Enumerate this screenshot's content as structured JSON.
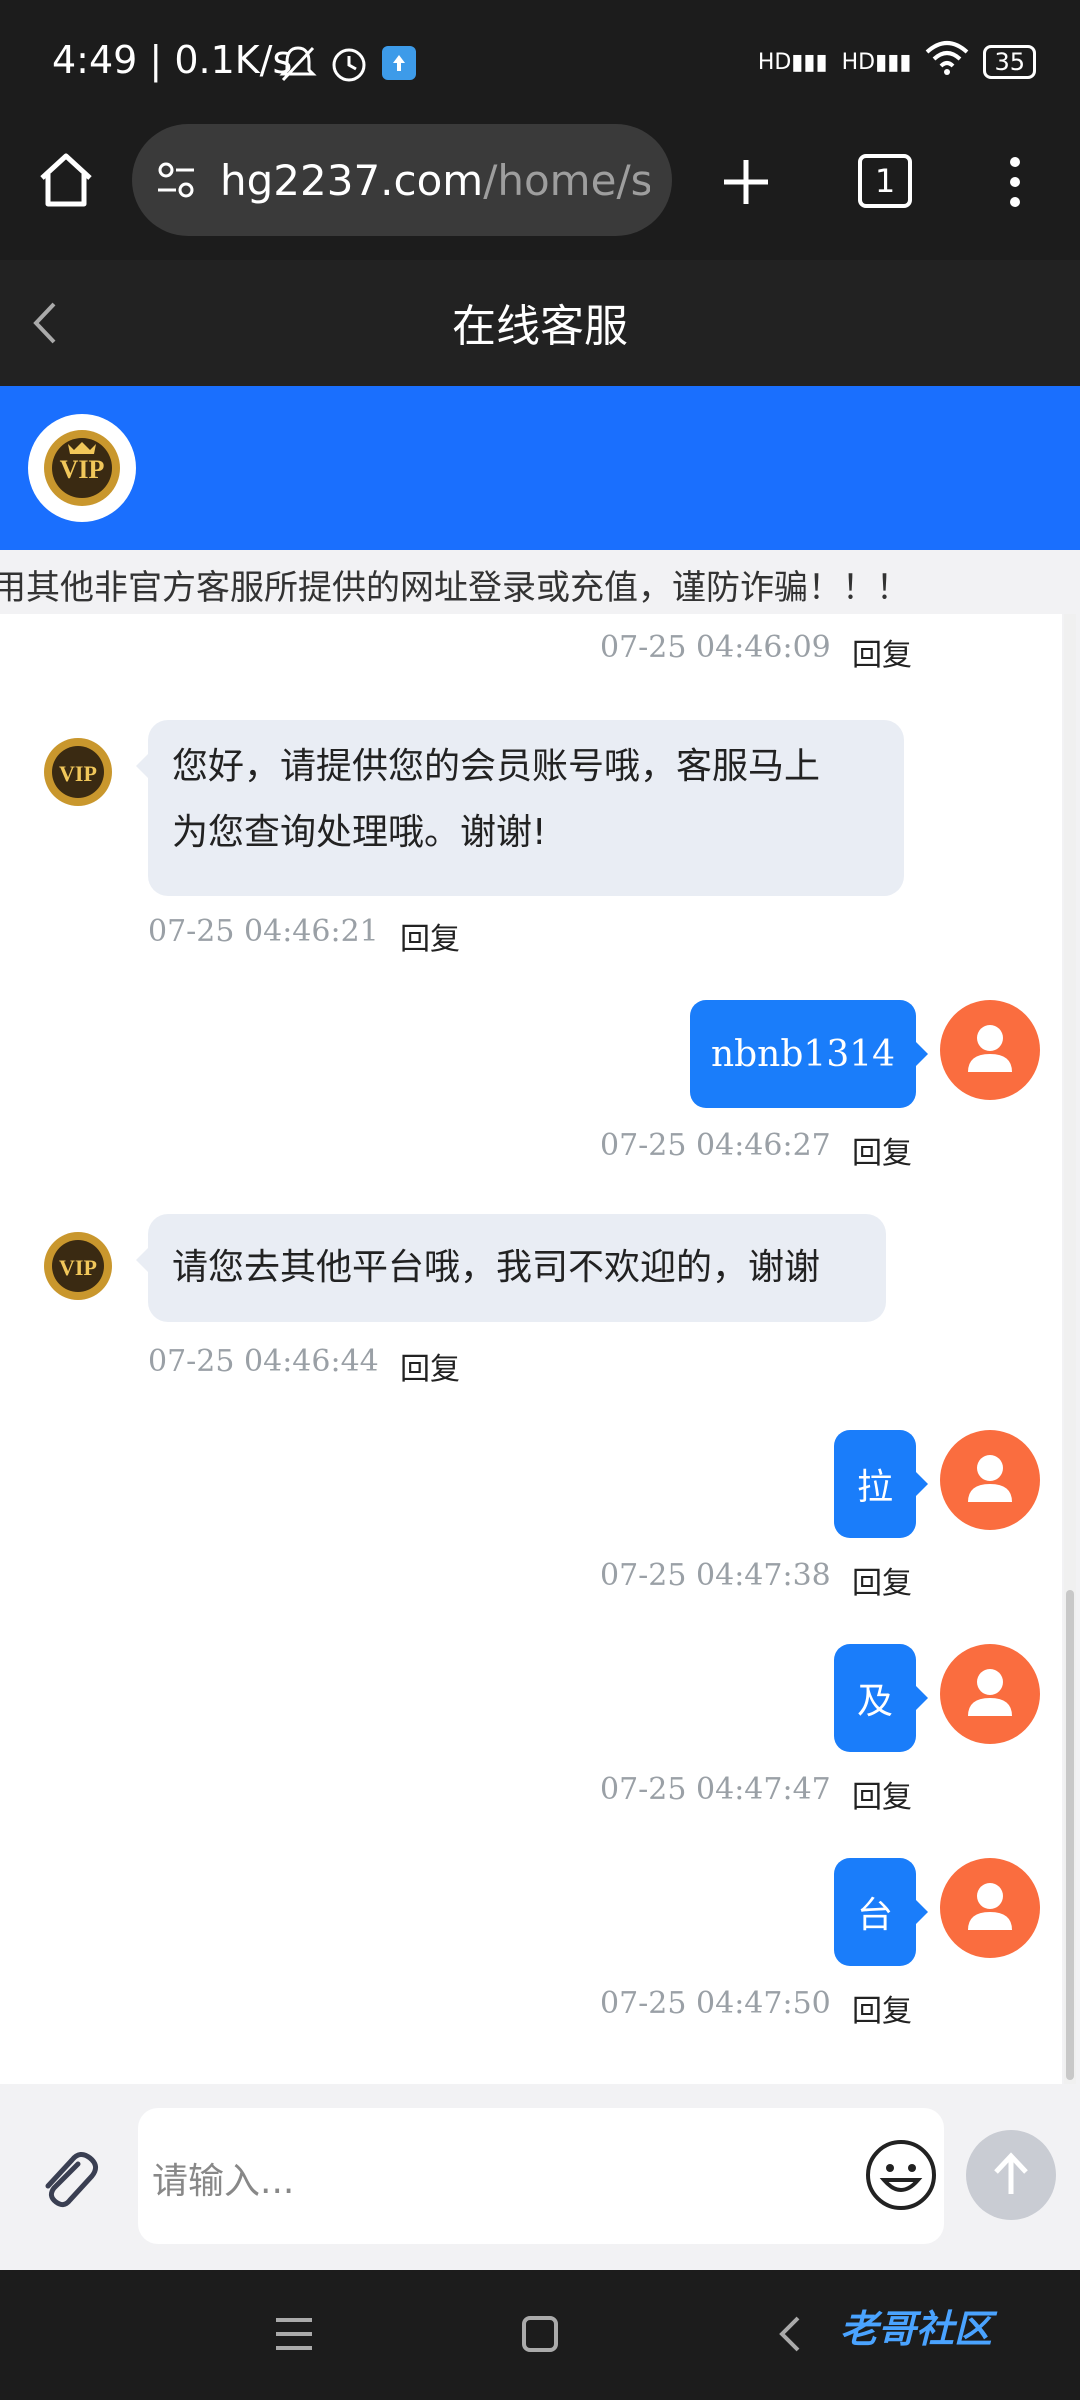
{
  "status": {
    "time": "4:49",
    "speed": "0.1K/s",
    "battery": "35"
  },
  "browser": {
    "url_host": "hg2237.com",
    "url_path": "/home/se",
    "tab_count": "1"
  },
  "header": {
    "title": "在线客服"
  },
  "notice": {
    "text": "用其他非官方客服所提供的网址登录或充值，谨防诈骗！！！"
  },
  "chat": {
    "reply_label": "回复",
    "top_timestamp": "07-25 04:46:09",
    "messages": [
      {
        "side": "left",
        "lines": [
          "您好，请提供您的会员账号哦，客服马上",
          "为您查询处理哦。谢谢!"
        ],
        "time": "07-25 04:46:21"
      },
      {
        "side": "right",
        "text": "nbnb1314",
        "time": "07-25 04:46:27"
      },
      {
        "side": "left",
        "lines": [
          "请您去其他平台哦，我司不欢迎的，谢谢"
        ],
        "time": "07-25 04:46:44"
      },
      {
        "side": "right",
        "text": "拉",
        "time": "07-25 04:47:38"
      },
      {
        "side": "right",
        "text": "及",
        "time": "07-25 04:47:47"
      },
      {
        "side": "right",
        "text": "台",
        "time": "07-25 04:47:50"
      }
    ]
  },
  "input": {
    "placeholder": "请输入..."
  },
  "watermark": "老哥社区",
  "colors": {
    "accent": "#1a6ffe",
    "user_avatar": "#fa6d3f",
    "bubble_agent": "#e9edf4",
    "bubble_user": "#1a7dfa"
  }
}
